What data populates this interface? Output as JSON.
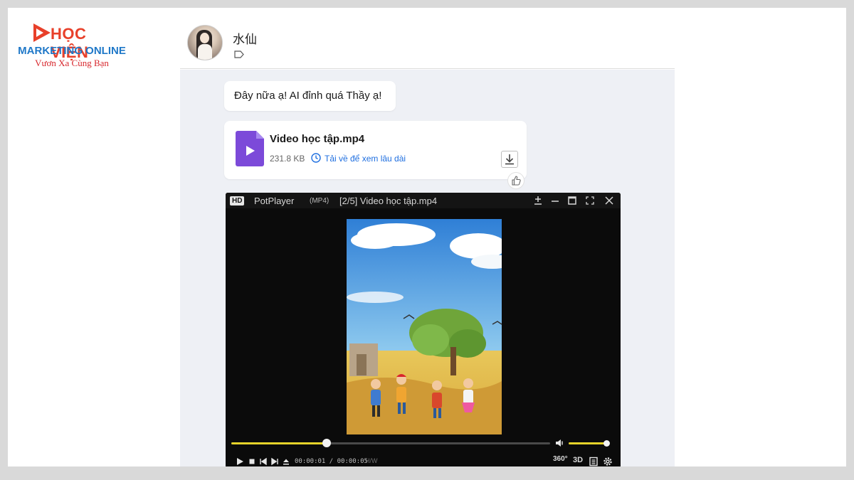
{
  "logo": {
    "line1": "HỌC VIỆN",
    "line2": "MARKETING ONLINE",
    "line3": "Vươn Xa Cùng Bạn"
  },
  "chat": {
    "contact_name": "水仙",
    "messages": [
      {
        "type": "text",
        "text": "Đây nữa ạ! AI đỉnh quá Thầy ạ!"
      },
      {
        "type": "file",
        "file_name": "Video học tập.mp4",
        "file_size": "231.8 KB",
        "link_text": "Tải về để xem lâu dài"
      }
    ]
  },
  "player": {
    "badge": "HD",
    "app_name": "PotPlayer",
    "format": "(MP4)",
    "file_title": "[2/5] Video học tập.mp4",
    "time_text": "00:00:01 / 00:00:05",
    "codec_text": "H/W",
    "r360_label": "360°",
    "r3d_label": "3D",
    "progress": 0.3,
    "volume": 0.95
  },
  "colors": {
    "accent_link": "#1f6fe0",
    "file_icon": "#7c4ad9",
    "seek_fill": "#e6d32a",
    "logo_red": "#e8402a",
    "logo_blue": "#1f78c8"
  }
}
